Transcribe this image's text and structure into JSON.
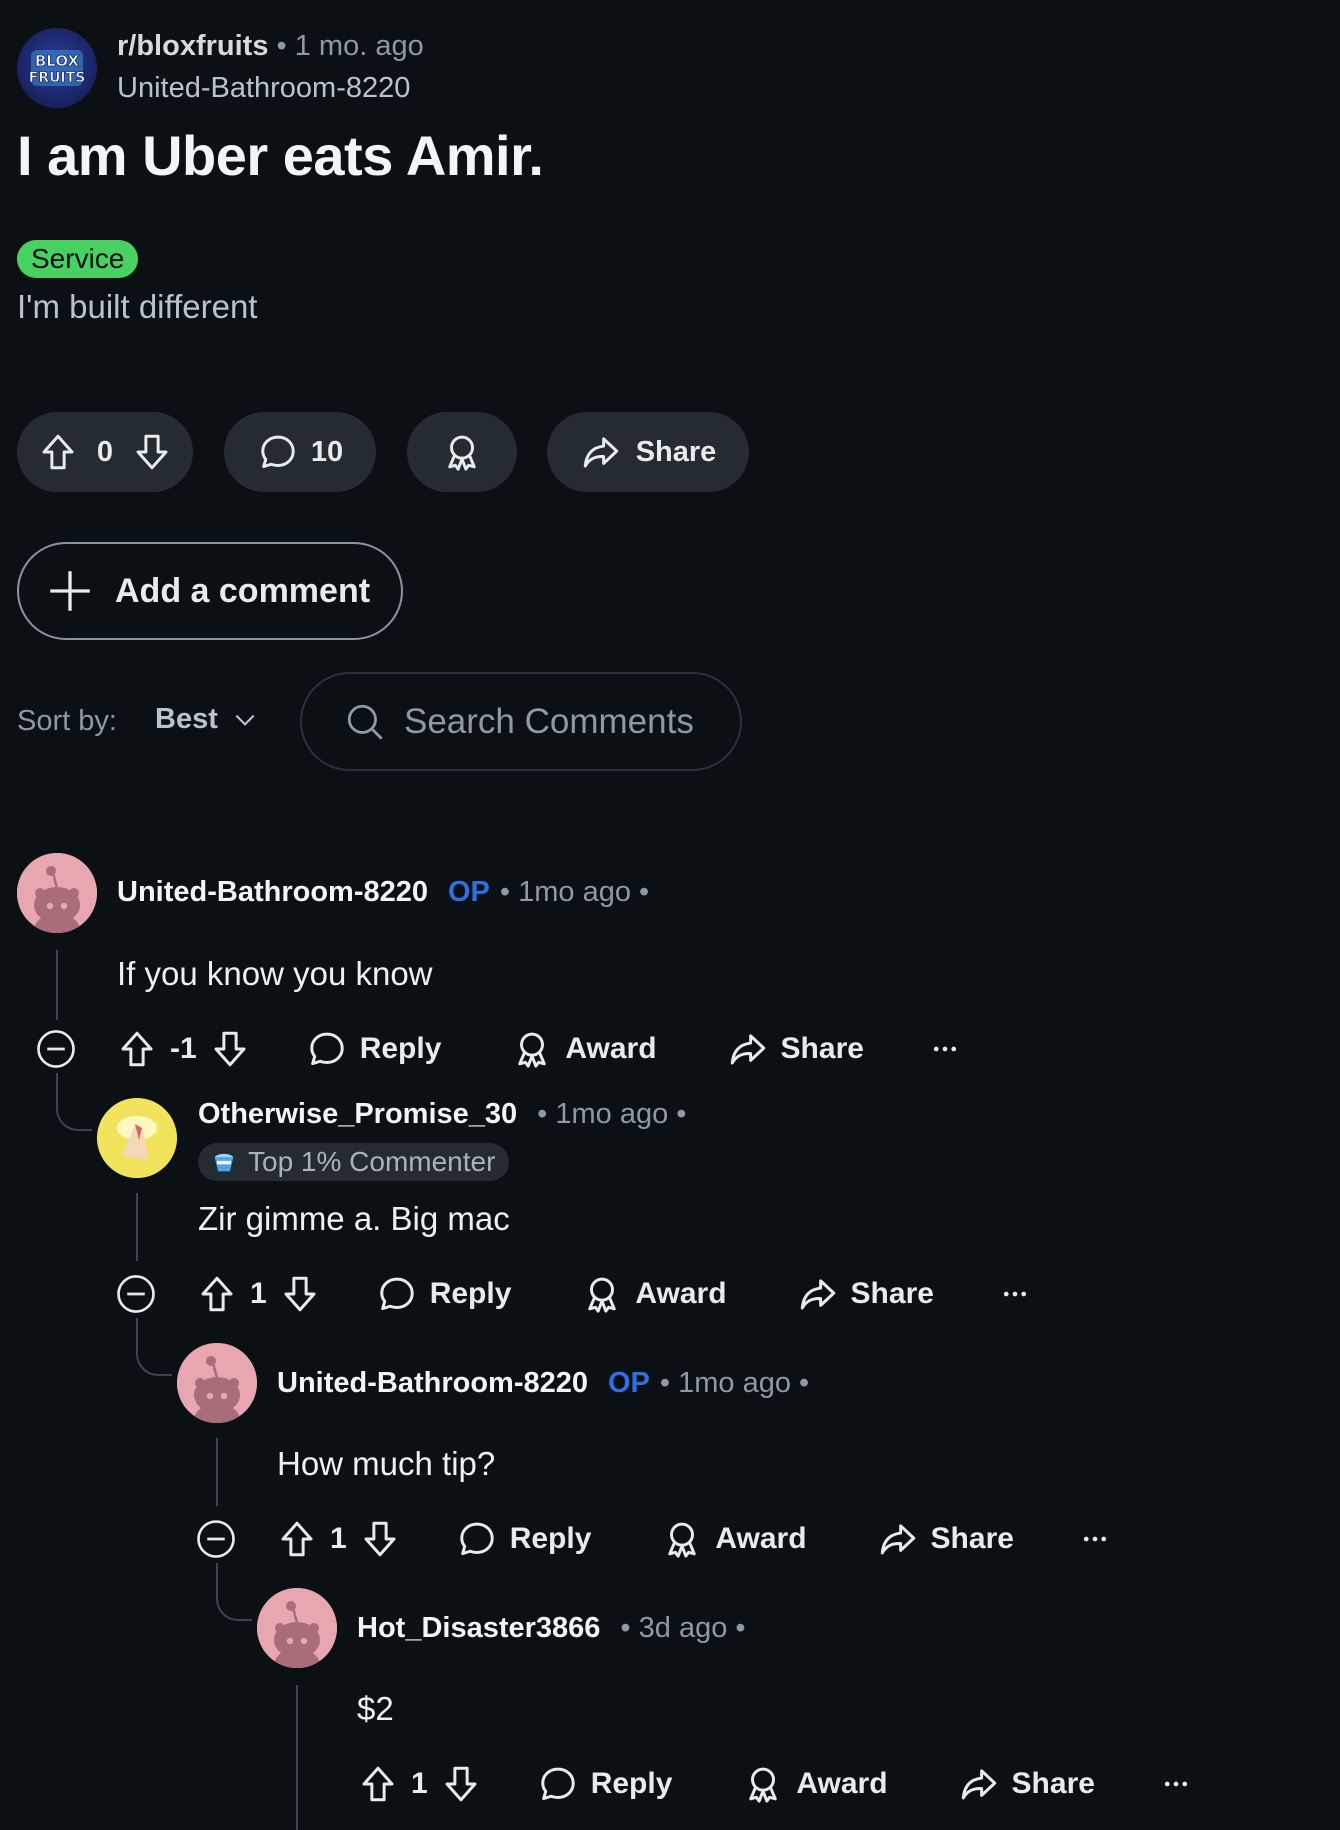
{
  "post": {
    "subreddit": "r/bloxfruits",
    "time": "• 1 mo. ago",
    "subreddit_icon_text": "BLOX FRUITS",
    "author": "United-Bathroom-8220",
    "title": "I am Uber eats Amir.",
    "flair": "Service",
    "body": "I'm built different",
    "votes": "0",
    "comments": "10",
    "share_label": "Share"
  },
  "add_comment_label": "Add a comment",
  "sort": {
    "label": "Sort by:",
    "value": "Best"
  },
  "search": {
    "placeholder": "Search Comments",
    "value": ""
  },
  "comments": [
    {
      "user": "United-Bathroom-8220",
      "op": "OP",
      "meta": "• 1mo ago •",
      "text": "If you  know you know",
      "votes": "-1"
    },
    {
      "user": "Otherwise_Promise_30",
      "op": "",
      "meta": "• 1mo ago •",
      "badge": "Top 1% Commenter",
      "text": "Zir gimme a. Big mac",
      "votes": "1"
    },
    {
      "user": "United-Bathroom-8220",
      "op": "OP",
      "meta": "• 1mo ago •",
      "text": "How much tip?",
      "votes": "1"
    },
    {
      "user": "Hot_Disaster3866",
      "op": "",
      "meta": "• 3d ago •",
      "text": "$2",
      "votes": "1"
    }
  ],
  "actions": {
    "reply": "Reply",
    "award": "Award",
    "share": "Share",
    "more": "•••"
  },
  "colors": {
    "background": "#0b1015",
    "pill": "#242b31",
    "flair": "#46d160",
    "op": "#2f6fdf",
    "avatar": "#e8a6b0"
  },
  "icons": [
    "upvote-icon",
    "downvote-icon",
    "comment-icon",
    "award-icon",
    "share-icon",
    "plus-icon",
    "search-icon",
    "chevron-down-icon",
    "collapse-icon",
    "more-icon"
  ]
}
